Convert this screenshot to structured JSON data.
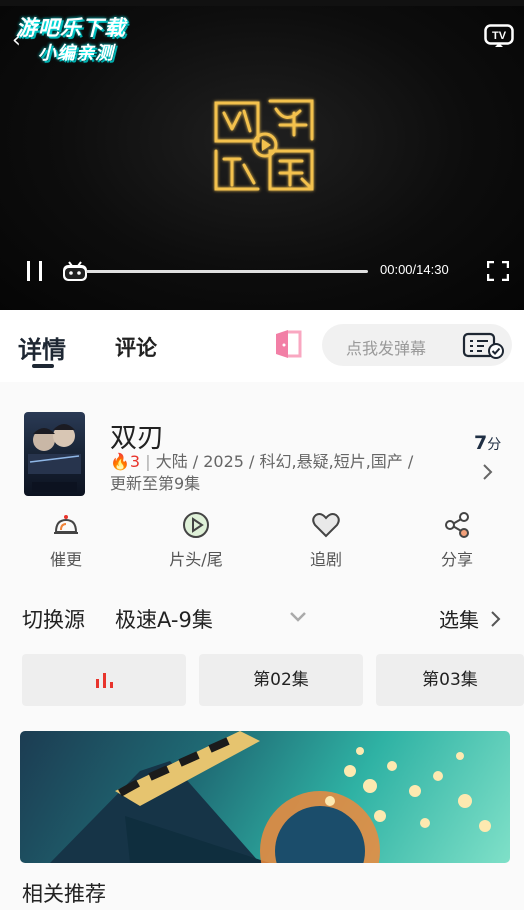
{
  "player": {
    "watermark_line1": "游吧乐下载",
    "watermark_line2": "小编亲测",
    "logo_text": "网络视听",
    "time": "00:00/14:30",
    "progress": 0
  },
  "tabs": {
    "detail": "详情",
    "comment": "评论",
    "danmu_placeholder": "点我发弹幕"
  },
  "show": {
    "title": "双刃",
    "hot": "3",
    "meta": "大陆 / 2025 / 科幻,悬疑,短片,国产 /",
    "update": "更新至第9集",
    "score": "7",
    "score_unit": "分"
  },
  "actions": [
    {
      "label": "催更",
      "icon": "bell-icon"
    },
    {
      "label": "片头/尾",
      "icon": "play-circle-icon"
    },
    {
      "label": "追剧",
      "icon": "heart-icon"
    },
    {
      "label": "分享",
      "icon": "share-icon"
    }
  ],
  "source": {
    "label": "切换源",
    "value": "极速A-9集",
    "select_label": "选集"
  },
  "episodes": [
    {
      "label": "",
      "playing": true
    },
    {
      "label": "第02集",
      "playing": false
    },
    {
      "label": "第03集",
      "playing": false
    }
  ],
  "sections": {
    "related": "相关推荐"
  },
  "colors": {
    "accent": "#1e2733",
    "hot": "#e8342c",
    "playing": "#e8342c"
  }
}
